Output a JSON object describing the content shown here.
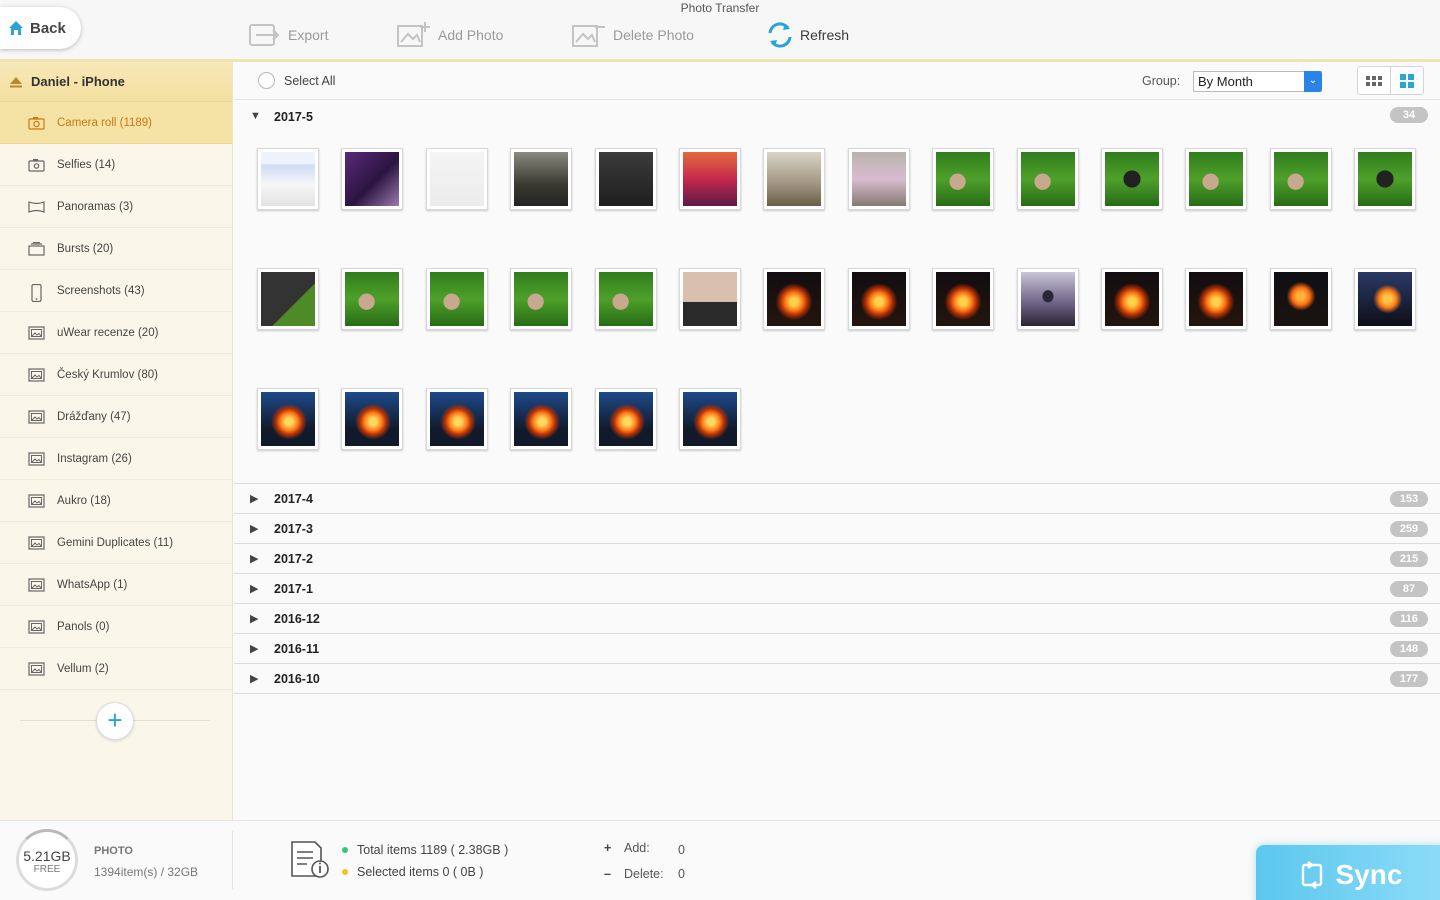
{
  "window": {
    "title": "Photo Transfer"
  },
  "toolbar": {
    "back": "Back",
    "export": "Export",
    "add_photo": "Add Photo",
    "delete_photo": "Delete Photo",
    "refresh": "Refresh"
  },
  "device": {
    "name": "Daniel - iPhone"
  },
  "albums": [
    {
      "label": "Camera roll (1189)",
      "icon": "camera-icon",
      "active": true
    },
    {
      "label": "Selfies (14)",
      "icon": "selfie-camera-icon"
    },
    {
      "label": "Panoramas (3)",
      "icon": "panorama-icon"
    },
    {
      "label": "Bursts (20)",
      "icon": "bursts-icon"
    },
    {
      "label": "Screenshots (43)",
      "icon": "phone-icon"
    },
    {
      "label": "uWear recenze (20)",
      "icon": "album-icon"
    },
    {
      "label": "Český Krumlov (80)",
      "icon": "album-icon"
    },
    {
      "label": "Drážďany (47)",
      "icon": "album-icon"
    },
    {
      "label": "Instagram (26)",
      "icon": "album-icon"
    },
    {
      "label": "Aukro (18)",
      "icon": "album-icon"
    },
    {
      "label": "Gemini Duplicates (11)",
      "icon": "album-icon"
    },
    {
      "label": "WhatsApp (1)",
      "icon": "album-icon"
    },
    {
      "label": "Panols (0)",
      "icon": "album-icon"
    },
    {
      "label": "Vellum (2)",
      "icon": "album-icon"
    }
  ],
  "header": {
    "select_all": "Select All",
    "group_label": "Group:",
    "group_value": "By Month"
  },
  "open_section": {
    "label": "2017-5",
    "count": "34",
    "photos": [
      "screenshot",
      "purple-package",
      "document",
      "phone-screen",
      "dark",
      "city-sunset",
      "building",
      "child",
      "grass-hand",
      "grass-hand",
      "grass-phone",
      "grass-hand",
      "grass-hand",
      "grass-phone",
      "phone-back",
      "grass-hand",
      "grass-hand",
      "grass-hand",
      "grass-hand",
      "skin",
      "fire-night",
      "fire-night",
      "fire-night",
      "person-fire",
      "fire-night",
      "fire-night",
      "people-fire",
      "fire-dusk",
      "fire-blue",
      "fire-blue",
      "fire-blue",
      "fire-blue",
      "fire-blue",
      "fire-blue"
    ]
  },
  "sections": [
    {
      "label": "2017-4",
      "count": "153"
    },
    {
      "label": "2017-3",
      "count": "259"
    },
    {
      "label": "2017-2",
      "count": "215"
    },
    {
      "label": "2017-1",
      "count": "87"
    },
    {
      "label": "2016-12",
      "count": "116"
    },
    {
      "label": "2016-11",
      "count": "148"
    },
    {
      "label": "2016-10",
      "count": "177"
    }
  ],
  "footer": {
    "free_size": "5.21GB",
    "free_label": "FREE",
    "category": "PHOTO",
    "items": "1394item(s) / 32GB",
    "total_items": "Total items 1189 ( 2.38GB )",
    "selected_items": "Selected items 0 ( 0B )",
    "add_symbol": "+",
    "add_label": "Add:",
    "add_value": "0",
    "delete_symbol": "–",
    "delete_label": "Delete:",
    "delete_value": "0",
    "sync": "Sync"
  },
  "colors": {
    "accent": "#2aa3d8",
    "active_album_text": "#c97a12",
    "sidebar_active_bg": "#f5e2a5",
    "total_dot": "#2ecc71",
    "selected_dot": "#f1c40f"
  }
}
